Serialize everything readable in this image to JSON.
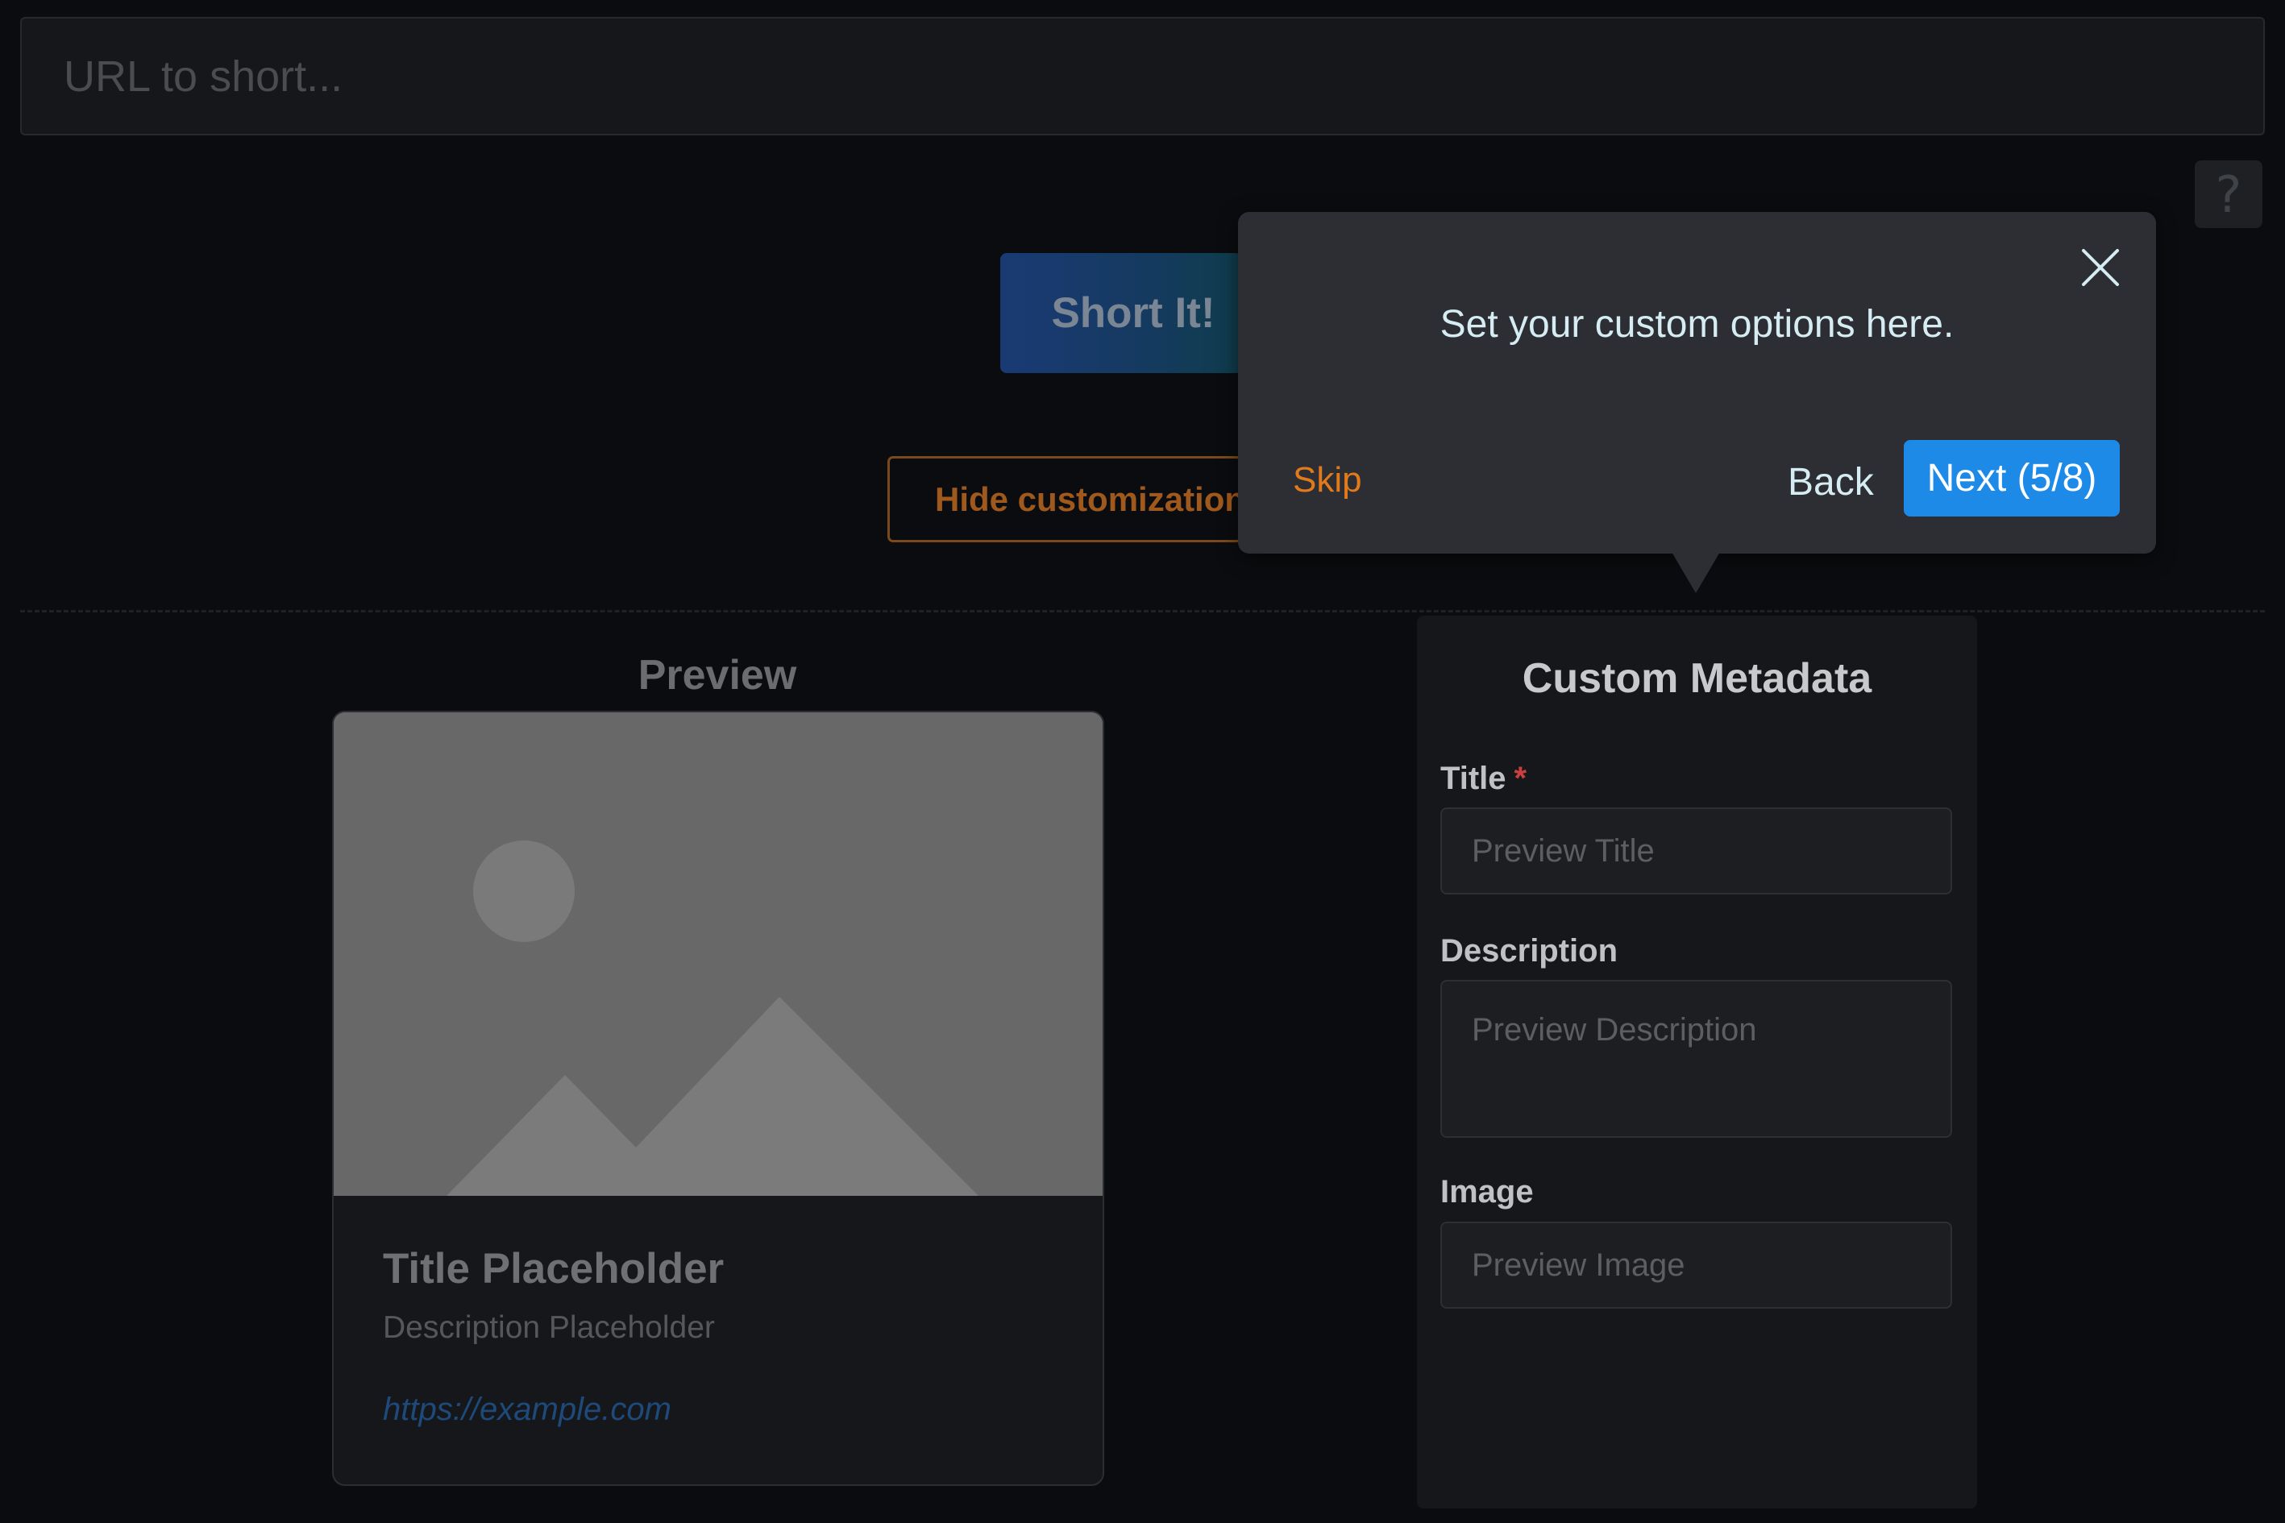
{
  "url_input": {
    "placeholder": "URL to short..."
  },
  "help_button": {
    "label": "?"
  },
  "actions": {
    "short_label": "Short It!",
    "hide_customization_label": "Hide customization"
  },
  "preview": {
    "heading": "Preview",
    "image_icon": "image-placeholder-icon",
    "card_title": "Title Placeholder",
    "card_description": "Description Placeholder",
    "card_url": "https://example.com"
  },
  "metadata": {
    "heading": "Custom Metadata",
    "fields": [
      {
        "label": "Title",
        "required_mark": "*",
        "placeholder": "Preview Title"
      },
      {
        "label": "Description",
        "placeholder": "Preview Description"
      },
      {
        "label": "Image",
        "placeholder": "Preview Image"
      }
    ]
  },
  "tour": {
    "message": "Set your custom options here.",
    "skip_label": "Skip",
    "back_label": "Back",
    "next_label": "Next (5/8)",
    "close_icon": "close-icon"
  },
  "colors": {
    "background": "#0b0c0f",
    "panel": "#16171a",
    "accent_blue": "#1e8ae8",
    "accent_orange": "#e07a1a",
    "required_red": "#c94040"
  }
}
